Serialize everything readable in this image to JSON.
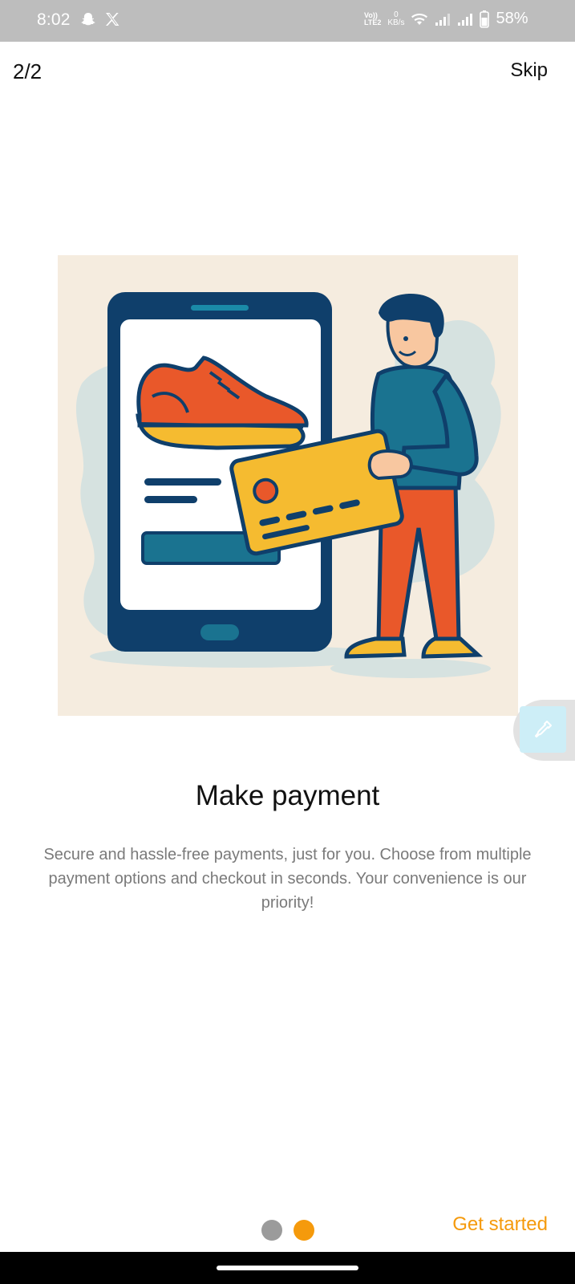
{
  "status_bar": {
    "time": "8:02",
    "volte_top": "Vo))",
    "volte_bottom": "LTE2",
    "kbs_value": "0",
    "kbs_unit": "KB/s",
    "battery_percent": "58%",
    "icons": [
      "snapchat-icon",
      "x-icon",
      "wifi-icon",
      "signal-icon",
      "signal-icon",
      "battery-icon"
    ]
  },
  "header": {
    "page_counter": "2/2",
    "skip_label": "Skip"
  },
  "onboarding": {
    "title": "Make payment",
    "description": "Secure and hassle-free payments, just for you. Choose from multiple payment options and checkout in seconds. Your convenience is our priority!",
    "page_indicator": {
      "total": 2,
      "current": 2
    }
  },
  "footer": {
    "get_started_label": "Get started"
  },
  "colors": {
    "accent": "#f59a0c",
    "dot_inactive": "#9b9b9b",
    "illustration_bg": "#f5ecdf",
    "phone_navy": "#0f3f6b",
    "shoe_orange": "#e9582a",
    "card_yellow": "#f5bb30",
    "shirt_teal": "#1a7390"
  }
}
